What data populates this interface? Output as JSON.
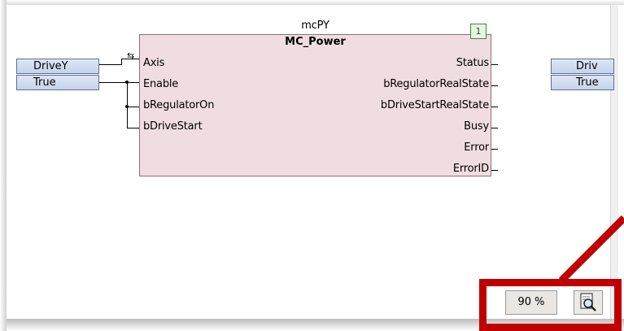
{
  "block": {
    "instance_name": "mcPY",
    "type_name": "MC_Power",
    "order_badge": "1",
    "inputs": [
      "Axis",
      "Enable",
      "bRegulatorOn",
      "bDriveStart"
    ],
    "outputs": [
      "Status",
      "bRegulatorRealState",
      "bDriveStartRealState",
      "Busy",
      "Error",
      "ErrorID"
    ]
  },
  "left_vars": {
    "axis_var": "DriveY",
    "enable_var": "True"
  },
  "right_vars": {
    "axis_var": "Driv",
    "enable_var": "True"
  },
  "statusbar": {
    "zoom_value": "90 %"
  },
  "icons": {
    "zoom_icon": "magnifier-document-icon",
    "axis_inout_icon": "bidirectional-arrow-icon"
  },
  "colors": {
    "block_fill": "#f0dde2",
    "var_fill": "#c5d3ea",
    "highlight": "#c00000"
  }
}
